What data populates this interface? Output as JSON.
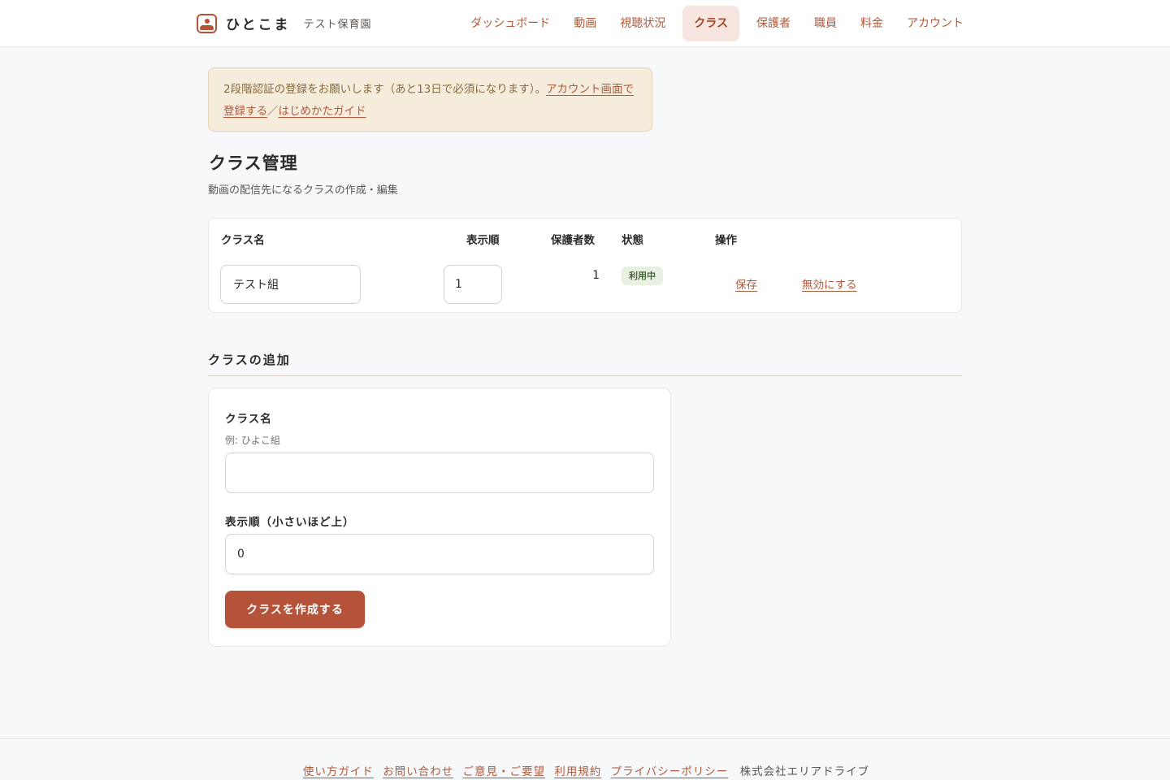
{
  "brand": {
    "name": "ひとこま",
    "org": "テスト保育園",
    "logo_icon": "photo-frame-icon",
    "accent_color": "#b5533a"
  },
  "nav": {
    "items": [
      {
        "label": "ダッシュボード"
      },
      {
        "label": "動画"
      },
      {
        "label": "視聴状況"
      },
      {
        "label": "クラス",
        "active": true
      },
      {
        "label": "保護者"
      },
      {
        "label": "職員"
      },
      {
        "label": "料金"
      },
      {
        "label": "アカウント"
      }
    ]
  },
  "alert": {
    "text": "2段階認証の登録をお願いします（あと13日で必須になります）。",
    "link1": "アカウント画面で登録する",
    "separator": "／",
    "link2": "はじめかたガイド"
  },
  "page": {
    "title": "クラス管理",
    "subtitle": "動画の配信先になるクラスの作成・編集"
  },
  "table": {
    "headers": {
      "name": "クラス名",
      "order": "表示順",
      "guardians": "保護者数",
      "status": "状態",
      "actions": "操作"
    },
    "rows": [
      {
        "name": "テスト組",
        "order": "1",
        "guardians": "1",
        "status": "利用中",
        "save_label": "保存",
        "disable_label": "無効にする"
      }
    ]
  },
  "add_section": {
    "heading": "クラスの追加",
    "name_label": "クラス名",
    "name_hint": "例: ひよこ組",
    "name_value": "",
    "order_label": "表示順（小さいほど上）",
    "order_value": "0",
    "submit_label": "クラスを作成する"
  },
  "footer": {
    "links": [
      {
        "label": "使い方ガイド"
      },
      {
        "label": "お問い合わせ"
      },
      {
        "label": "ご意見・ご要望"
      },
      {
        "label": "利用規約"
      },
      {
        "label": "プライバシーポリシー"
      }
    ],
    "company": "株式会社エリアドライブ"
  }
}
